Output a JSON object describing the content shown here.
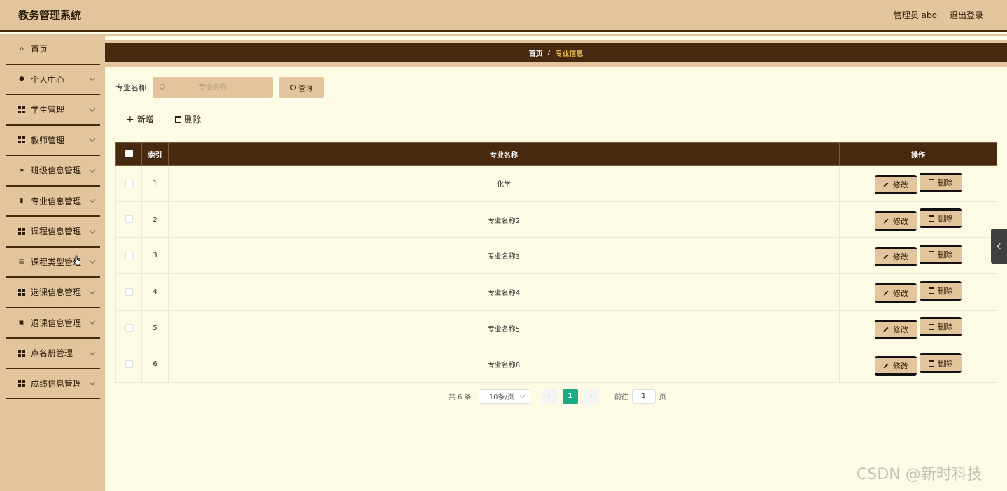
{
  "header": {
    "app_title": "教务管理系统",
    "user_label": "管理员 abo",
    "logout_label": "退出登录"
  },
  "sidebar": {
    "items": [
      {
        "label": "首页",
        "icon": "home-icon",
        "expandable": false
      },
      {
        "label": "个人中心",
        "icon": "user-icon",
        "expandable": true
      },
      {
        "label": "学生管理",
        "icon": "grid-icon",
        "expandable": true
      },
      {
        "label": "教师管理",
        "icon": "grid-icon",
        "expandable": true
      },
      {
        "label": "班级信息管理",
        "icon": "send-icon",
        "expandable": true
      },
      {
        "label": "专业信息管理",
        "icon": "ticket-icon",
        "expandable": true
      },
      {
        "label": "课程信息管理",
        "icon": "grid-icon",
        "expandable": true
      },
      {
        "label": "课程类型管理",
        "icon": "document-icon",
        "expandable": true
      },
      {
        "label": "选课信息管理",
        "icon": "grid-icon",
        "expandable": true
      },
      {
        "label": "退课信息管理",
        "icon": "chat-icon",
        "expandable": true
      },
      {
        "label": "点名册管理",
        "icon": "grid-icon",
        "expandable": true
      },
      {
        "label": "成绩信息管理",
        "icon": "grid-icon",
        "expandable": true
      }
    ]
  },
  "breadcrumb": {
    "home": "首页",
    "separator": "/",
    "current": "专业信息"
  },
  "search": {
    "label": "专业名称",
    "placeholder": "专业名称",
    "value": "",
    "button_label": "查询"
  },
  "toolbar": {
    "add_label": "新增",
    "delete_label": "删除"
  },
  "table": {
    "columns": [
      "索引",
      "专业名称",
      "操作"
    ],
    "rows": [
      {
        "index": "1",
        "name": "化学"
      },
      {
        "index": "2",
        "name": "专业名称2"
      },
      {
        "index": "3",
        "name": "专业名称3"
      },
      {
        "index": "4",
        "name": "专业名称4"
      },
      {
        "index": "5",
        "name": "专业名称5"
      },
      {
        "index": "6",
        "name": "专业名称6"
      }
    ],
    "edit_label": "修改",
    "delete_label": "删除"
  },
  "pagination": {
    "total_text": "共 6 条",
    "page_size": "10条/页",
    "current_page": "1",
    "goto_label": "前往",
    "goto_value": "1",
    "goto_suffix": "页"
  },
  "watermark": "CSDN @新时科技",
  "colors": {
    "header_bg": "#e3c59d",
    "dark_brown": "#47290f",
    "content_bg": "#fdfbe4",
    "accent_green": "#1aab84",
    "breadcrumb_current": "#e8b84a"
  }
}
